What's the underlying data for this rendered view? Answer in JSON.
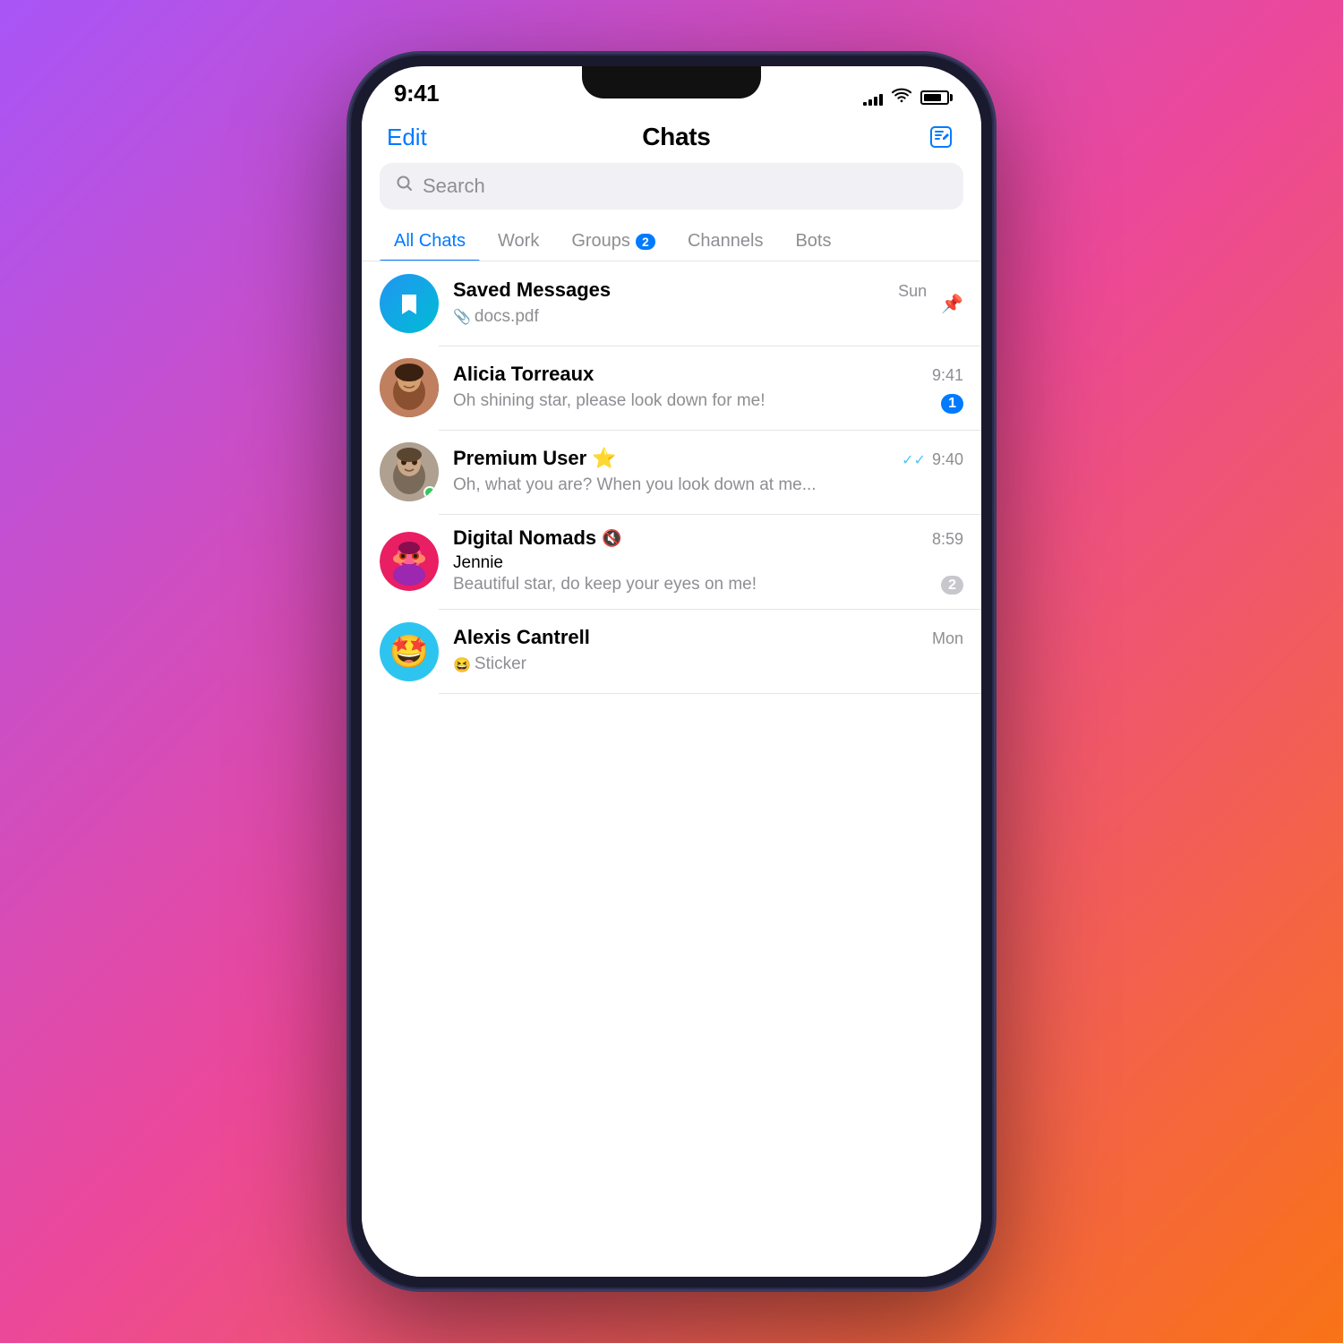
{
  "background": {
    "gradient_start": "#a855f7",
    "gradient_end": "#f97316"
  },
  "phone": {
    "status_bar": {
      "time": "9:41",
      "signal_bars": [
        4,
        7,
        10,
        13,
        16
      ],
      "wifi": "wifi",
      "battery": "battery"
    },
    "header": {
      "edit_label": "Edit",
      "title": "Chats",
      "compose_icon": "compose"
    },
    "search": {
      "placeholder": "Search"
    },
    "tabs": [
      {
        "id": "all-chats",
        "label": "All Chats",
        "active": true,
        "badge": null
      },
      {
        "id": "work",
        "label": "Work",
        "active": false,
        "badge": null
      },
      {
        "id": "groups",
        "label": "Groups",
        "active": false,
        "badge": "2"
      },
      {
        "id": "channels",
        "label": "Channels",
        "active": false,
        "badge": null
      },
      {
        "id": "bots",
        "label": "Bots",
        "active": false,
        "badge": null
      }
    ],
    "chats": [
      {
        "id": "saved-messages",
        "name": "Saved Messages",
        "avatar_type": "saved",
        "time": "Sun",
        "preview_icon": "📎",
        "preview": "docs.pdf",
        "pin": true,
        "unread": null,
        "online": false
      },
      {
        "id": "alicia-torreaux",
        "name": "Alicia Torreaux",
        "avatar_type": "photo-alicia",
        "time": "9:41",
        "preview": "Oh shining star, please look down for me!",
        "pin": false,
        "unread": "1",
        "unread_color": "blue",
        "online": false
      },
      {
        "id": "premium-user",
        "name": "Premium User",
        "avatar_type": "photo-premium",
        "time": "9:40",
        "preview": "Oh, what you are? When you look down at me...",
        "pin": false,
        "unread": null,
        "read_receipts": true,
        "online": true
      },
      {
        "id": "digital-nomads",
        "name": "Digital Nomads",
        "avatar_type": "photo-digital",
        "time": "8:59",
        "sender": "Jennie",
        "preview": "Beautiful star, do keep your eyes on me!",
        "pin": false,
        "unread": "2",
        "unread_color": "grey",
        "muted": true,
        "online": false
      },
      {
        "id": "alexis-cantrell",
        "name": "Alexis Cantrell",
        "avatar_type": "emoji",
        "avatar_emoji": "🤩",
        "time": "Mon",
        "preview_icon": "😆",
        "preview": "Sticker",
        "pin": false,
        "unread": null,
        "online": false
      }
    ]
  }
}
